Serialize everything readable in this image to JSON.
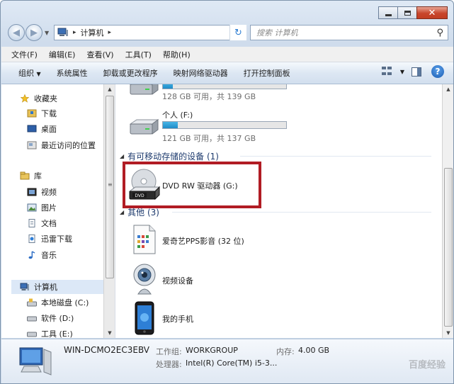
{
  "address": {
    "location": "计算机"
  },
  "search": {
    "placeholder": "搜索 计算机"
  },
  "menu": [
    "文件(F)",
    "编辑(E)",
    "查看(V)",
    "工具(T)",
    "帮助(H)"
  ],
  "toolbar": {
    "organize": "组织",
    "system_properties": "系统属性",
    "uninstall": "卸载或更改程序",
    "map_drive": "映射网络驱动器",
    "control_panel": "打开控制面板"
  },
  "sidebar": {
    "favorites": "收藏夹",
    "downloads": "下载",
    "desktop": "桌面",
    "recent": "最近访问的位置",
    "libraries": "库",
    "videos": "视频",
    "pictures": "图片",
    "documents": "文档",
    "thunder": "迅雷下载",
    "music": "音乐",
    "computer": "计算机",
    "local_c": "本地磁盘 (C:)",
    "soft_d": "软件 (D:)",
    "tools_e": "工具 (E:)"
  },
  "drives": [
    {
      "label": "",
      "size_text": "128 GB 可用，共 139 GB",
      "used_fraction": 0.08
    },
    {
      "label": "个人 (F:)",
      "size_text": "121 GB 可用，共 137 GB",
      "used_fraction": 0.12
    }
  ],
  "groups": {
    "removable": "有可移动存储的设备 (1)",
    "other": "其他 (3)"
  },
  "removable_items": [
    {
      "label": "DVD RW 驱动器 (G:)",
      "disc_text": "DVD"
    }
  ],
  "other_items": [
    {
      "label": "爱奇艺PPS影音 (32 位)"
    },
    {
      "label": "视频设备"
    },
    {
      "label": "我的手机"
    }
  ],
  "details": {
    "computer_name": "WIN-DCMO2EC3EBV",
    "workgroup_label": "工作组:",
    "workgroup": "WORKGROUP",
    "memory_label": "内存:",
    "memory": "4.00 GB",
    "processor_label": "处理器:",
    "processor": "Intel(R) Core(TM) i5-3...",
    "watermark": "百度经验"
  },
  "colors": {
    "highlight_box": "#b11c24",
    "drive_bar": "#2196d3",
    "group_heading": "#1e3b6e"
  }
}
